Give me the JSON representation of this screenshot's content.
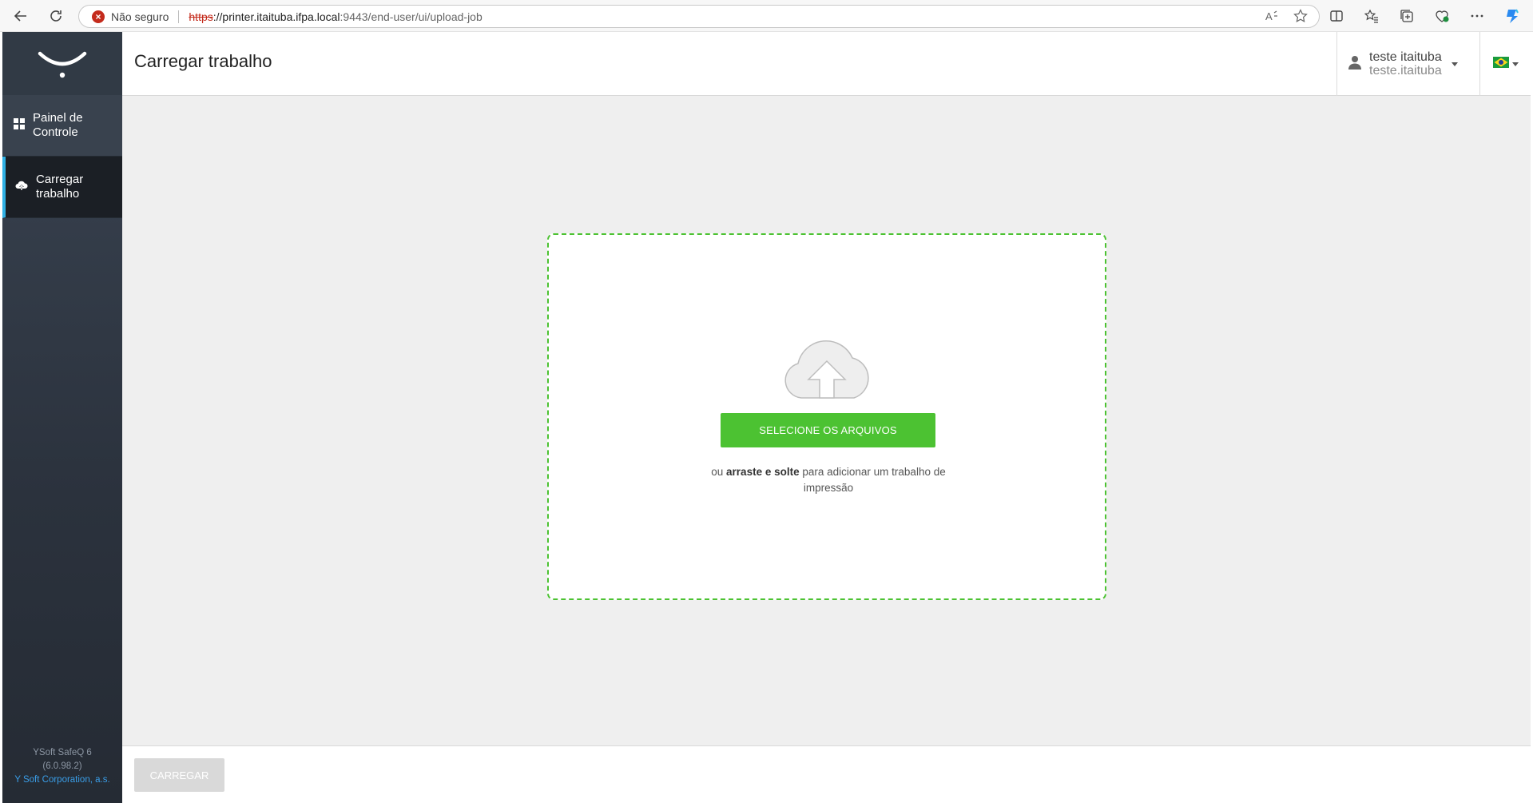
{
  "browser": {
    "security_label": "Não seguro",
    "url_scheme": "https",
    "url_host": "://printer.itaituba.ifpa.local",
    "url_path": ":9443/end-user/ui/upload-job"
  },
  "sidebar": {
    "items": [
      {
        "label": "Painel de Controle",
        "icon": "dashboard-grid-icon",
        "active": false
      },
      {
        "label": "Carregar trabalho",
        "icon": "cloud-upload-icon",
        "active": true
      }
    ],
    "footer": {
      "product": "YSoft SafeQ 6",
      "version": "(6.0.98.2)",
      "company": "Y Soft Corporation, a.s."
    }
  },
  "header": {
    "title": "Carregar trabalho",
    "user_name": "teste itaituba",
    "user_login": "teste.itaituba",
    "language_flag": "brazil-flag-icon"
  },
  "upload": {
    "select_button": "SELECIONE OS ARQUIVOS",
    "hint_prefix": "ou ",
    "hint_bold": "arraste e solte",
    "hint_suffix": " para adicionar um trabalho de impressão",
    "accent_color": "#4cc232"
  },
  "footer": {
    "upload_button": "CARREGAR"
  }
}
